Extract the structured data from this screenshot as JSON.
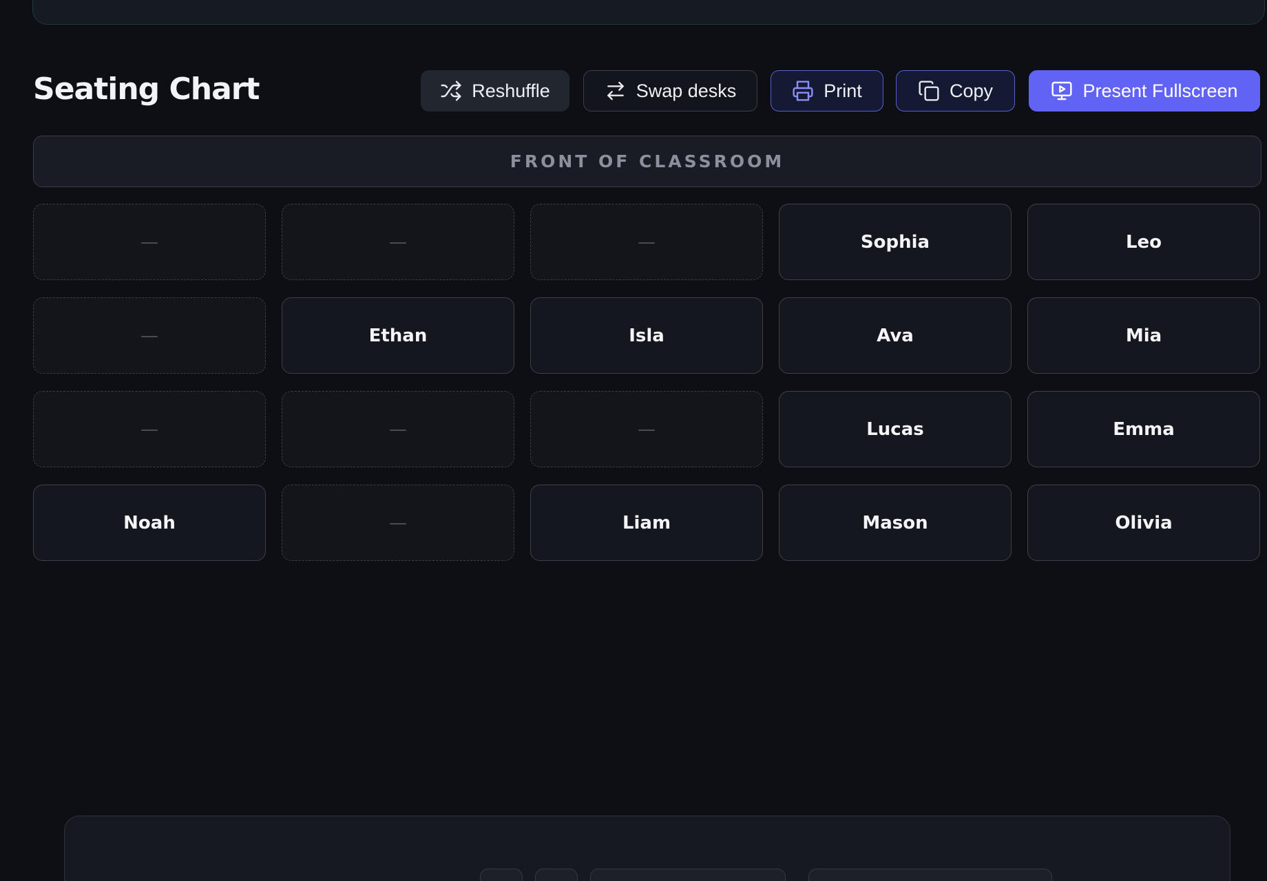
{
  "header": {
    "title": "Seating Chart"
  },
  "toolbar": {
    "reshuffle_label": "Reshuffle",
    "swap_label": "Swap desks",
    "print_label": "Print",
    "copy_label": "Copy",
    "present_label": "Present Fullscreen"
  },
  "classroom": {
    "front_label": "FRONT OF CLASSROOM",
    "empty_placeholder": "—",
    "desks": [
      "",
      "",
      "",
      "Sophia",
      "Leo",
      "",
      "Ethan",
      "Isla",
      "Ava",
      "Mia",
      "",
      "",
      "",
      "Lucas",
      "Emma",
      "Noah",
      "",
      "Liam",
      "Mason",
      "Olivia"
    ]
  },
  "colors": {
    "accent": "#6163f5",
    "background": "#0d0f14",
    "desk_border": "#3d414b"
  }
}
